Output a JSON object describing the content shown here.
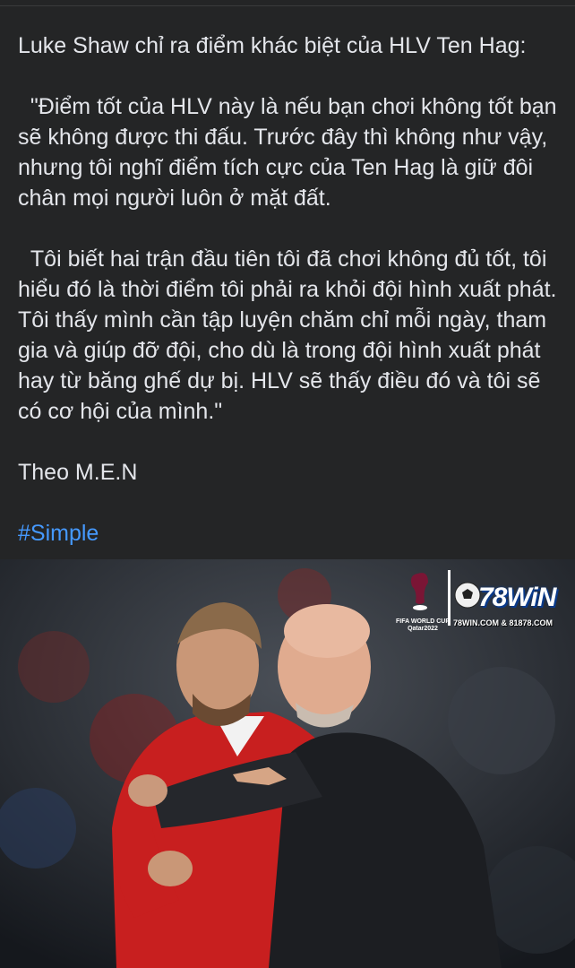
{
  "post": {
    "intro": "Luke Shaw chỉ ra điểm khác biệt của HLV Ten Hag:",
    "quote_1": "  \"Điểm tốt của HLV này là nếu bạn chơi không tốt bạn sẽ không được thi đấu. Trước đây thì không như vậy, nhưng tôi nghĩ điểm tích cực của Ten Hag là giữ đôi chân mọi người luôn ở mặt đất.",
    "quote_2": "  Tôi biết hai trận đầu tiên tôi đã chơi không đủ tốt, tôi hiểu đó là thời điểm tôi phải ra khỏi đội hình xuất phát. Tôi thấy mình cần tập luyện chăm chỉ mỗi ngày, tham gia và giúp đỡ đội, cho dù là trong đội hình xuất phát hay từ băng ghế dự bị. HLV sẽ thấy điều đó và tôi sẽ có cơ hội của mình.\"",
    "source": "Theo M.E.N",
    "hashtag": "#Simple"
  },
  "photo": {
    "watermark": {
      "wc_caption": "FIFA WORLD CUP Qatar2022",
      "brand": "78WiN",
      "url": "78WIN.COM & 81878.COM"
    }
  },
  "colors": {
    "background": "#242526",
    "text": "#e4e6eb",
    "link": "#4599ff"
  }
}
